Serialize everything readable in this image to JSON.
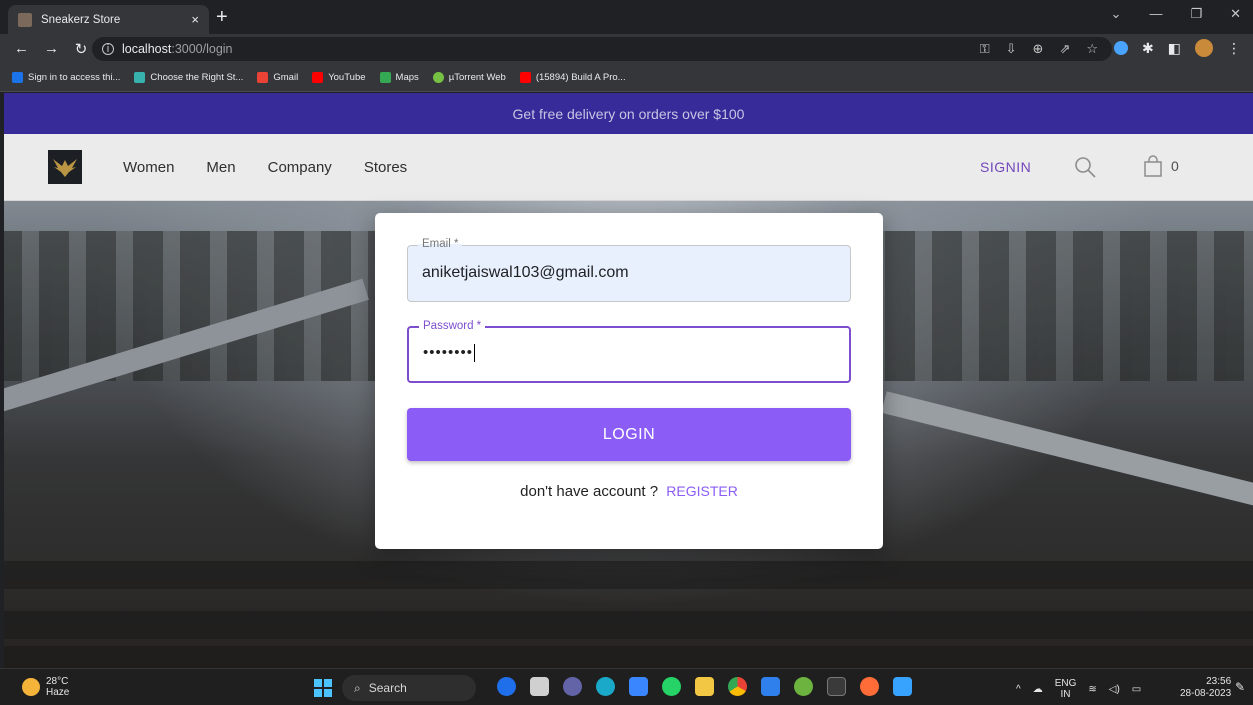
{
  "browser": {
    "tab_title": "Sneakerz Store",
    "tab_close": "×",
    "new_tab": "+",
    "url_host": "localhost",
    "url_path": ":3000/login",
    "bookmarks": [
      {
        "label": "Sign in to access thi...",
        "color": "#1a73e8"
      },
      {
        "label": "Choose the Right St...",
        "color": "#38b2ac"
      },
      {
        "label": "Gmail",
        "color": "#ea4335"
      },
      {
        "label": "YouTube",
        "color": "#ff0000"
      },
      {
        "label": "Maps",
        "color": "#34a853"
      },
      {
        "label": "µTorrent Web",
        "color": "#76c043"
      },
      {
        "label": "(15894) Build A Pro...",
        "color": "#ff0000"
      }
    ]
  },
  "site": {
    "promo": "Get free delivery on orders over $100",
    "menu": [
      "Women",
      "Men",
      "Company",
      "Stores"
    ],
    "signin": "SIGNIN",
    "cart_count": "0"
  },
  "login": {
    "email_label": "Email *",
    "email_value": "aniketjaiswal103@gmail.com",
    "password_label": "Password *",
    "password_value": "••••••••",
    "login_button": "LOGIN",
    "no_account": "don't have account ?",
    "register": "REGISTER",
    "accent": "#8b5cf6"
  },
  "taskbar": {
    "temp": "28°C",
    "weather": "Haze",
    "search": "Search",
    "lang": "ENG",
    "region": "IN",
    "time": "23:56",
    "date": "28-08-2023"
  }
}
